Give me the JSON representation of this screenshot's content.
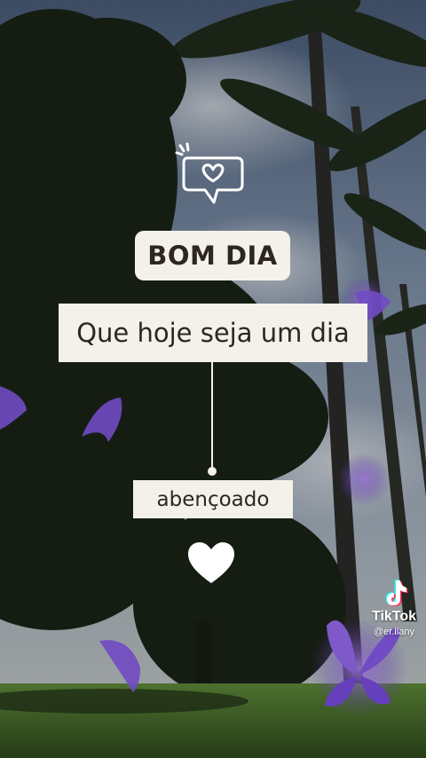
{
  "greeting": {
    "title": "BOM DIA",
    "line1": "Que hoje seja um dia",
    "line2": "abençoado"
  },
  "watermark": {
    "brand": "TikTok",
    "username": "@er.llany"
  },
  "icons": {
    "chat": "chat-bubble-heart-icon",
    "heart": "heart-icon",
    "logo": "tiktok-logo-icon"
  },
  "colors": {
    "card_bg": "#f4f1ea",
    "card_text": "#2d2622",
    "butterfly": "#8a5cf0"
  }
}
